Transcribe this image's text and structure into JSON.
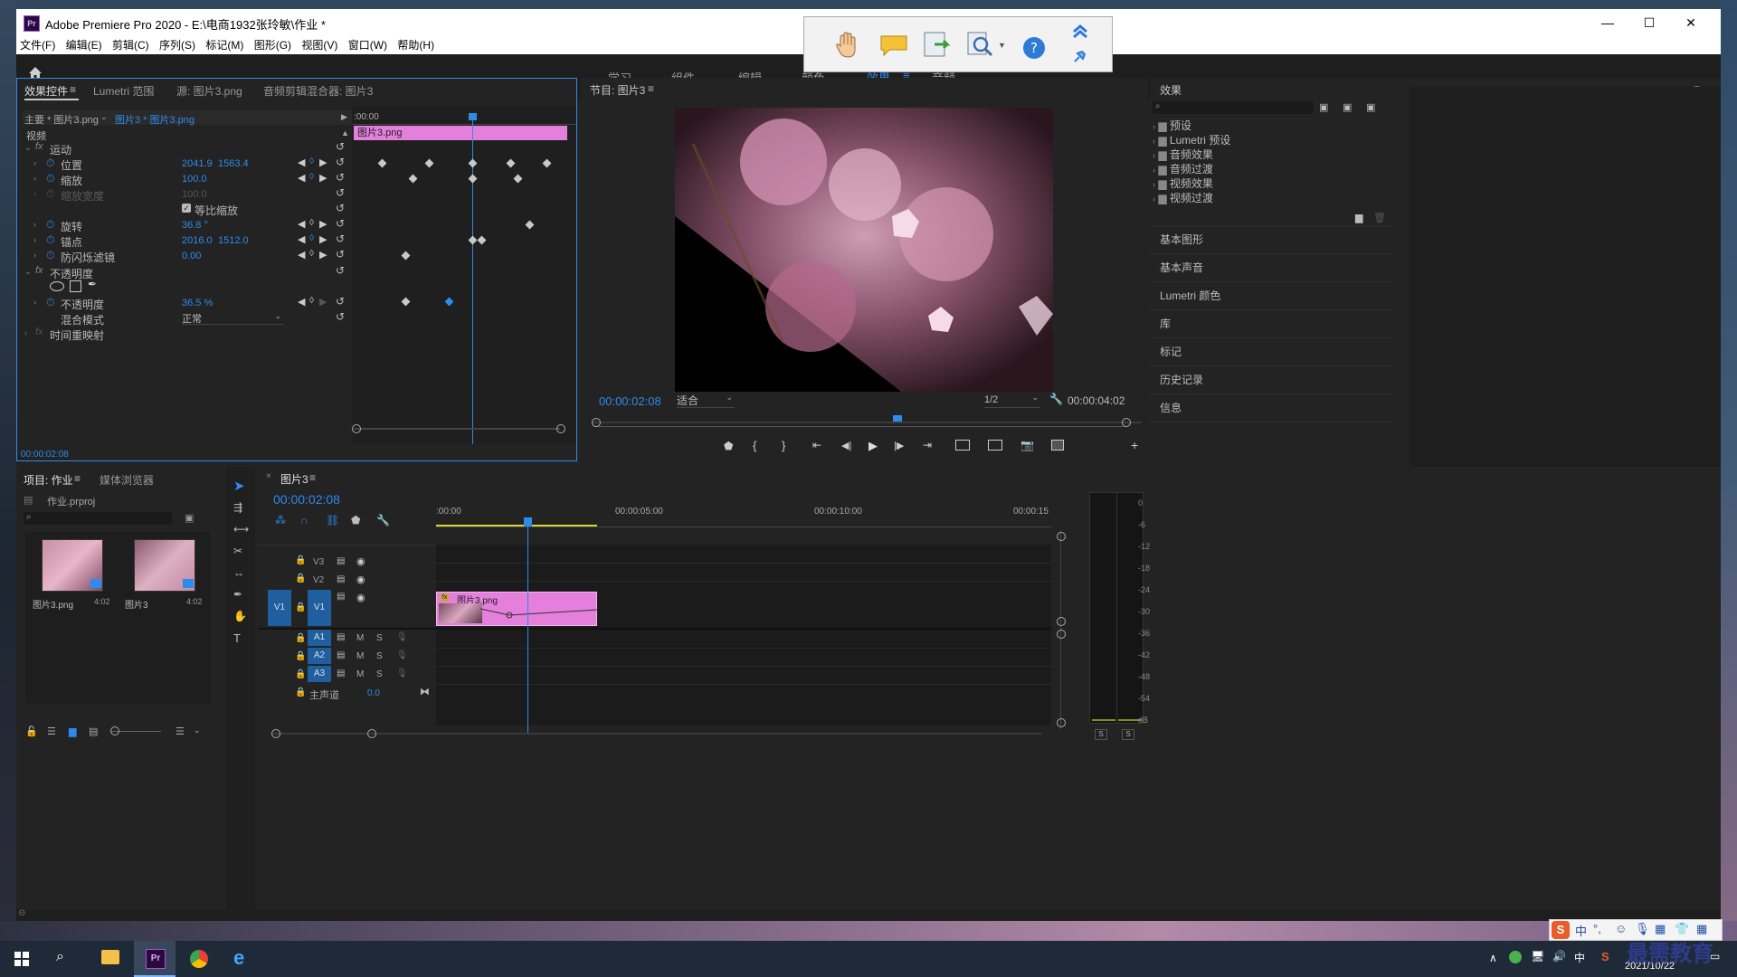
{
  "window": {
    "title": "Adobe Premiere Pro 2020 - E:\\电商1932张玲敏\\作业 *",
    "controls": {
      "minimize": "—",
      "maximize": "☐",
      "close": "✕"
    }
  },
  "menu": [
    "文件(F)",
    "编辑(E)",
    "剪辑(C)",
    "序列(S)",
    "标记(M)",
    "图形(G)",
    "视图(V)",
    "窗口(W)",
    "帮助(H)"
  ],
  "workspaces": [
    "学习",
    "组件",
    "编辑",
    "颜色",
    "效果",
    "音频"
  ],
  "effect_controls": {
    "tabs": [
      "效果控件",
      "Lumetri 范围",
      "源: 图片3.png",
      "音频剪辑混合器: 图片3"
    ],
    "master": "主要 * 图片3.png",
    "sequence_clip": "图片3 * 图片3.png",
    "video_label": "视频",
    "ruler_start": ":00:00",
    "clip_bar": "图片3.png",
    "motion": "运动",
    "rows": [
      {
        "label": "位置",
        "v1": "2041.9",
        "v2": "1563.4"
      },
      {
        "label": "缩放",
        "v1": "100.0",
        "v2": ""
      },
      {
        "label": "缩放宽度",
        "v1": "100.0",
        "v2": ""
      },
      {
        "label": "旋转",
        "v1": "36.8 °",
        "v2": ""
      },
      {
        "label": "锚点",
        "v1": "2016.0",
        "v2": "1512.0"
      },
      {
        "label": "防闪烁滤镜",
        "v1": "0.00",
        "v2": ""
      }
    ],
    "uniform_scale": "等比缩放",
    "opacity_group": "不透明度",
    "opacity_label": "不透明度",
    "opacity_value": "36.5 %",
    "blend_label": "混合模式",
    "blend_value": "正常",
    "time_remap": "时间重映射",
    "timecode": "00:00:02:08"
  },
  "program": {
    "title": "节目: 图片3",
    "timecode": "00:00:02:08",
    "fit": "适合",
    "quality": "1/2",
    "duration": "00:00:04:02"
  },
  "effects_panel": {
    "title": "效果",
    "items": [
      "预设",
      "Lumetri 预设",
      "音频效果",
      "音频过渡",
      "视频效果",
      "视频过渡"
    ]
  },
  "side_panels": [
    "基本图形",
    "基本声音",
    "Lumetri 颜色",
    "库",
    "标记",
    "历史记录",
    "信息"
  ],
  "project": {
    "tabs": [
      "项目: 作业",
      "媒体浏览器"
    ],
    "file": "作业.prproj",
    "items": [
      {
        "name": "图片3.png",
        "duration": "4:02"
      },
      {
        "name": "图片3",
        "duration": "4:02"
      }
    ]
  },
  "timeline": {
    "title": "图片3",
    "timecode": "00:00:02:08",
    "ruler": [
      ":00:00",
      "00:00:05:00",
      "00:00:10:00",
      "00:00:15"
    ],
    "video_tracks": [
      "V3",
      "V2",
      "V1"
    ],
    "source_patch": "V1",
    "audio_tracks": [
      "A1",
      "A2",
      "A3"
    ],
    "master": "主声道",
    "master_value": "0.0",
    "clip_name": "图片3.png",
    "mute_label": "M",
    "solo_label": "S"
  },
  "meter": {
    "scale": [
      "0",
      "-6",
      "-12",
      "-18",
      "-24",
      "-30",
      "-36",
      "-42",
      "-48",
      "-54",
      "dB"
    ],
    "buttons": [
      "S",
      "S"
    ]
  },
  "taskbar": {
    "date": "2021/10/22",
    "ime": "中",
    "watermark": "最需教育"
  },
  "colors": {
    "accent": "#2d8ceb",
    "clip": "#e47fdc",
    "playhead": "#2d8ceb"
  }
}
